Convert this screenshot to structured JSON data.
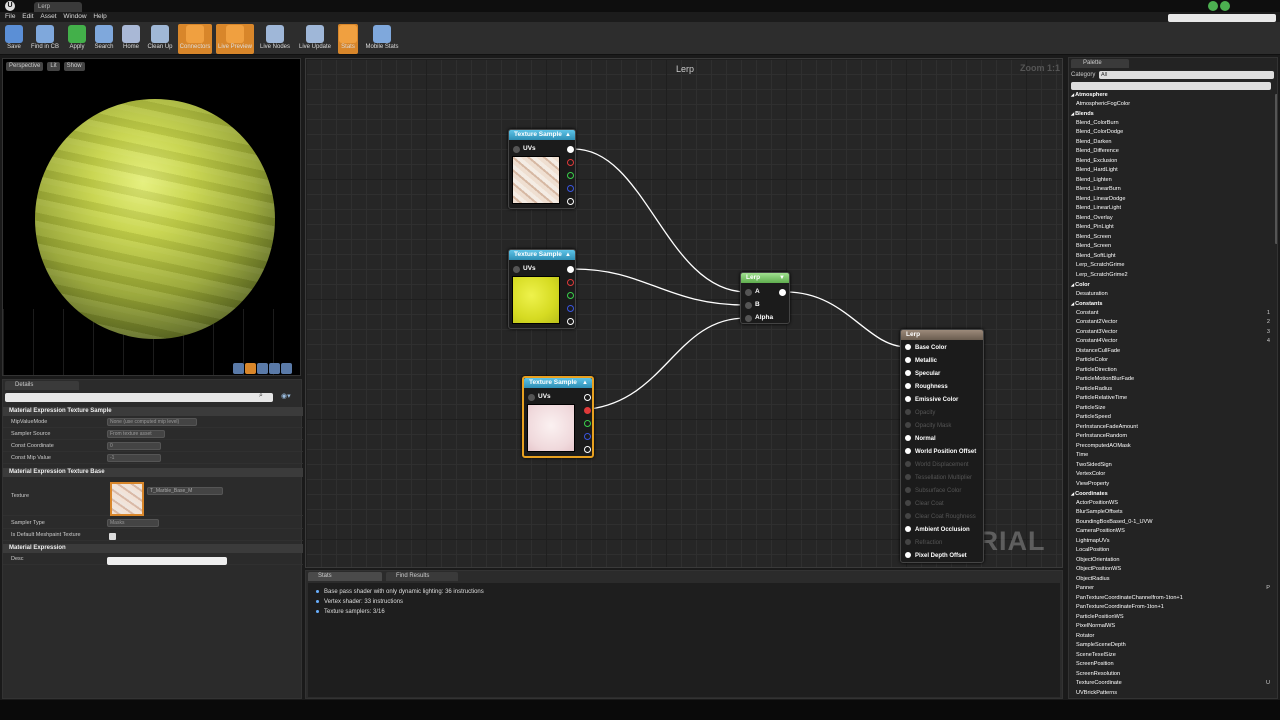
{
  "app": {
    "tab_title": "Lerp",
    "logo": "ue-logo"
  },
  "menu": [
    "File",
    "Edit",
    "Asset",
    "Window",
    "Help"
  ],
  "toolbar": [
    {
      "label": "Save",
      "active": false,
      "color": "#5b8fd6"
    },
    {
      "label": "Find in CB",
      "active": false,
      "color": "#7fa8dc"
    },
    {
      "label": "Apply",
      "active": false,
      "color": "#43b04a"
    },
    {
      "label": "Search",
      "active": false,
      "color": "#7fa8dc"
    },
    {
      "label": "Home",
      "active": false,
      "color": "#a9b8d6"
    },
    {
      "label": "Clean Up",
      "active": false,
      "color": "#a0b8d6"
    },
    {
      "label": "Connectors",
      "active": true,
      "color": "#f0a040"
    },
    {
      "label": "Live Preview",
      "active": true,
      "color": "#f0a040"
    },
    {
      "label": "Live Nodes",
      "active": false,
      "color": "#9fb7d8"
    },
    {
      "label": "Live Update",
      "active": false,
      "color": "#9fb7d8"
    },
    {
      "label": "Stats",
      "active": true,
      "color": "#f0a040"
    },
    {
      "label": "Mobile Stats",
      "active": false,
      "color": "#7fa8dc"
    }
  ],
  "viewport": {
    "buttons": [
      "Perspective",
      "Lit",
      "Show"
    ]
  },
  "details": {
    "tab": "Details",
    "sections": [
      {
        "title": "Material Expression Texture Sample"
      },
      {
        "title": "Material Expression Texture Base"
      },
      {
        "title": "Material Expression"
      }
    ],
    "props": {
      "mip_mode": {
        "label": "MipValueMode",
        "value": "None (use computed mip level)"
      },
      "sampler_source": {
        "label": "Sampler Source",
        "value": "From texture asset"
      },
      "const_coord": {
        "label": "Const Coordinate",
        "value": "0"
      },
      "const_mip": {
        "label": "Const Mip Value",
        "value": "-1"
      },
      "texture": {
        "label": "Texture",
        "value": "T_Marble_Base_M"
      },
      "sampler_type": {
        "label": "Sampler Type",
        "value": "Masks"
      },
      "default_mesh": {
        "label": "Is Default Meshpaint Texture"
      },
      "desc": {
        "label": "Desc"
      }
    }
  },
  "graph": {
    "title": "Lerp",
    "zoom": "Zoom 1:1",
    "watermark": "MATERIAL",
    "ts_header": "Texture Sample",
    "uvs": "UVs",
    "lerp": {
      "title": "Lerp",
      "a": "A",
      "b": "B",
      "alpha": "Alpha"
    },
    "material": {
      "title": "Lerp",
      "inputs": [
        {
          "label": "Base Color",
          "enabled": true
        },
        {
          "label": "Metallic",
          "enabled": true
        },
        {
          "label": "Specular",
          "enabled": true
        },
        {
          "label": "Roughness",
          "enabled": true
        },
        {
          "label": "Emissive Color",
          "enabled": true
        },
        {
          "label": "Opacity",
          "enabled": false
        },
        {
          "label": "Opacity Mask",
          "enabled": false
        },
        {
          "label": "Normal",
          "enabled": true
        },
        {
          "label": "World Position Offset",
          "enabled": true
        },
        {
          "label": "World Displacement",
          "enabled": false
        },
        {
          "label": "Tessellation Multiplier",
          "enabled": false
        },
        {
          "label": "Subsurface Color",
          "enabled": false
        },
        {
          "label": "Clear Coat",
          "enabled": false
        },
        {
          "label": "Clear Coat Roughness",
          "enabled": false
        },
        {
          "label": "Ambient Occlusion",
          "enabled": true
        },
        {
          "label": "Refraction",
          "enabled": false
        },
        {
          "label": "Pixel Depth Offset",
          "enabled": true
        }
      ]
    }
  },
  "stats": {
    "tabs": [
      "Stats",
      "Find Results"
    ],
    "lines": [
      "Base pass shader with only dynamic lighting: 36 instructions",
      "Vertex shader: 33 instructions",
      "Texture samplers: 3/16"
    ]
  },
  "palette": {
    "tab": "Palette",
    "category_label": "Category",
    "category_value": "All",
    "items": [
      {
        "t": "Atmosphere",
        "cat": true
      },
      {
        "t": "AtmosphericFogColor"
      },
      {
        "t": "Blends",
        "cat": true
      },
      {
        "t": "Blend_ColorBurn"
      },
      {
        "t": "Blend_ColorDodge"
      },
      {
        "t": "Blend_Darken"
      },
      {
        "t": "Blend_Difference"
      },
      {
        "t": "Blend_Exclusion"
      },
      {
        "t": "Blend_HardLight"
      },
      {
        "t": "Blend_Lighten"
      },
      {
        "t": "Blend_LinearBurn"
      },
      {
        "t": "Blend_LinearDodge"
      },
      {
        "t": "Blend_LinearLight"
      },
      {
        "t": "Blend_Overlay"
      },
      {
        "t": "Blend_PinLight"
      },
      {
        "t": "Blend_Screen"
      },
      {
        "t": "Blend_Screen"
      },
      {
        "t": "Blend_SoftLight"
      },
      {
        "t": "Lerp_ScratchGrime"
      },
      {
        "t": "Lerp_ScratchGrime2"
      },
      {
        "t": "Color",
        "cat": true
      },
      {
        "t": "Desaturation"
      },
      {
        "t": "Constants",
        "cat": true
      },
      {
        "t": "Constant",
        "hk": "1"
      },
      {
        "t": "Constant2Vector",
        "hk": "2"
      },
      {
        "t": "Constant3Vector",
        "hk": "3"
      },
      {
        "t": "Constant4Vector",
        "hk": "4"
      },
      {
        "t": "DistanceCullFade"
      },
      {
        "t": "ParticleColor"
      },
      {
        "t": "ParticleDirection"
      },
      {
        "t": "ParticleMotionBlurFade"
      },
      {
        "t": "ParticleRadius"
      },
      {
        "t": "ParticleRelativeTime"
      },
      {
        "t": "ParticleSize"
      },
      {
        "t": "ParticleSpeed"
      },
      {
        "t": "PerInstanceFadeAmount"
      },
      {
        "t": "PerInstanceRandom"
      },
      {
        "t": "PrecomputedAOMask"
      },
      {
        "t": "Time"
      },
      {
        "t": "TwoSidedSign"
      },
      {
        "t": "VertexColor"
      },
      {
        "t": "ViewProperty"
      },
      {
        "t": "Coordinates",
        "cat": true
      },
      {
        "t": "ActorPositionWS"
      },
      {
        "t": "BlurSampleOffsets"
      },
      {
        "t": "BoundingBoxBased_0-1_UVW"
      },
      {
        "t": "CameraPositionWS"
      },
      {
        "t": "LightmapUVs"
      },
      {
        "t": "LocalPosition"
      },
      {
        "t": "ObjectOrientation"
      },
      {
        "t": "ObjectPositionWS"
      },
      {
        "t": "ObjectRadius"
      },
      {
        "t": "Panner",
        "hk": "P"
      },
      {
        "t": "PanTextureCoordinateChannelfrom-1ton+1"
      },
      {
        "t": "PanTextureCoordinateFrom-1ton+1"
      },
      {
        "t": "ParticlePositionWS"
      },
      {
        "t": "PixelNormalWS"
      },
      {
        "t": "Rotator"
      },
      {
        "t": "SampleSceneDepth"
      },
      {
        "t": "SceneTexelSize"
      },
      {
        "t": "ScreenPosition"
      },
      {
        "t": "ScreenResolution"
      },
      {
        "t": "TextureCoordinate",
        "hk": "U"
      },
      {
        "t": "UVBrickPatterns"
      }
    ]
  }
}
